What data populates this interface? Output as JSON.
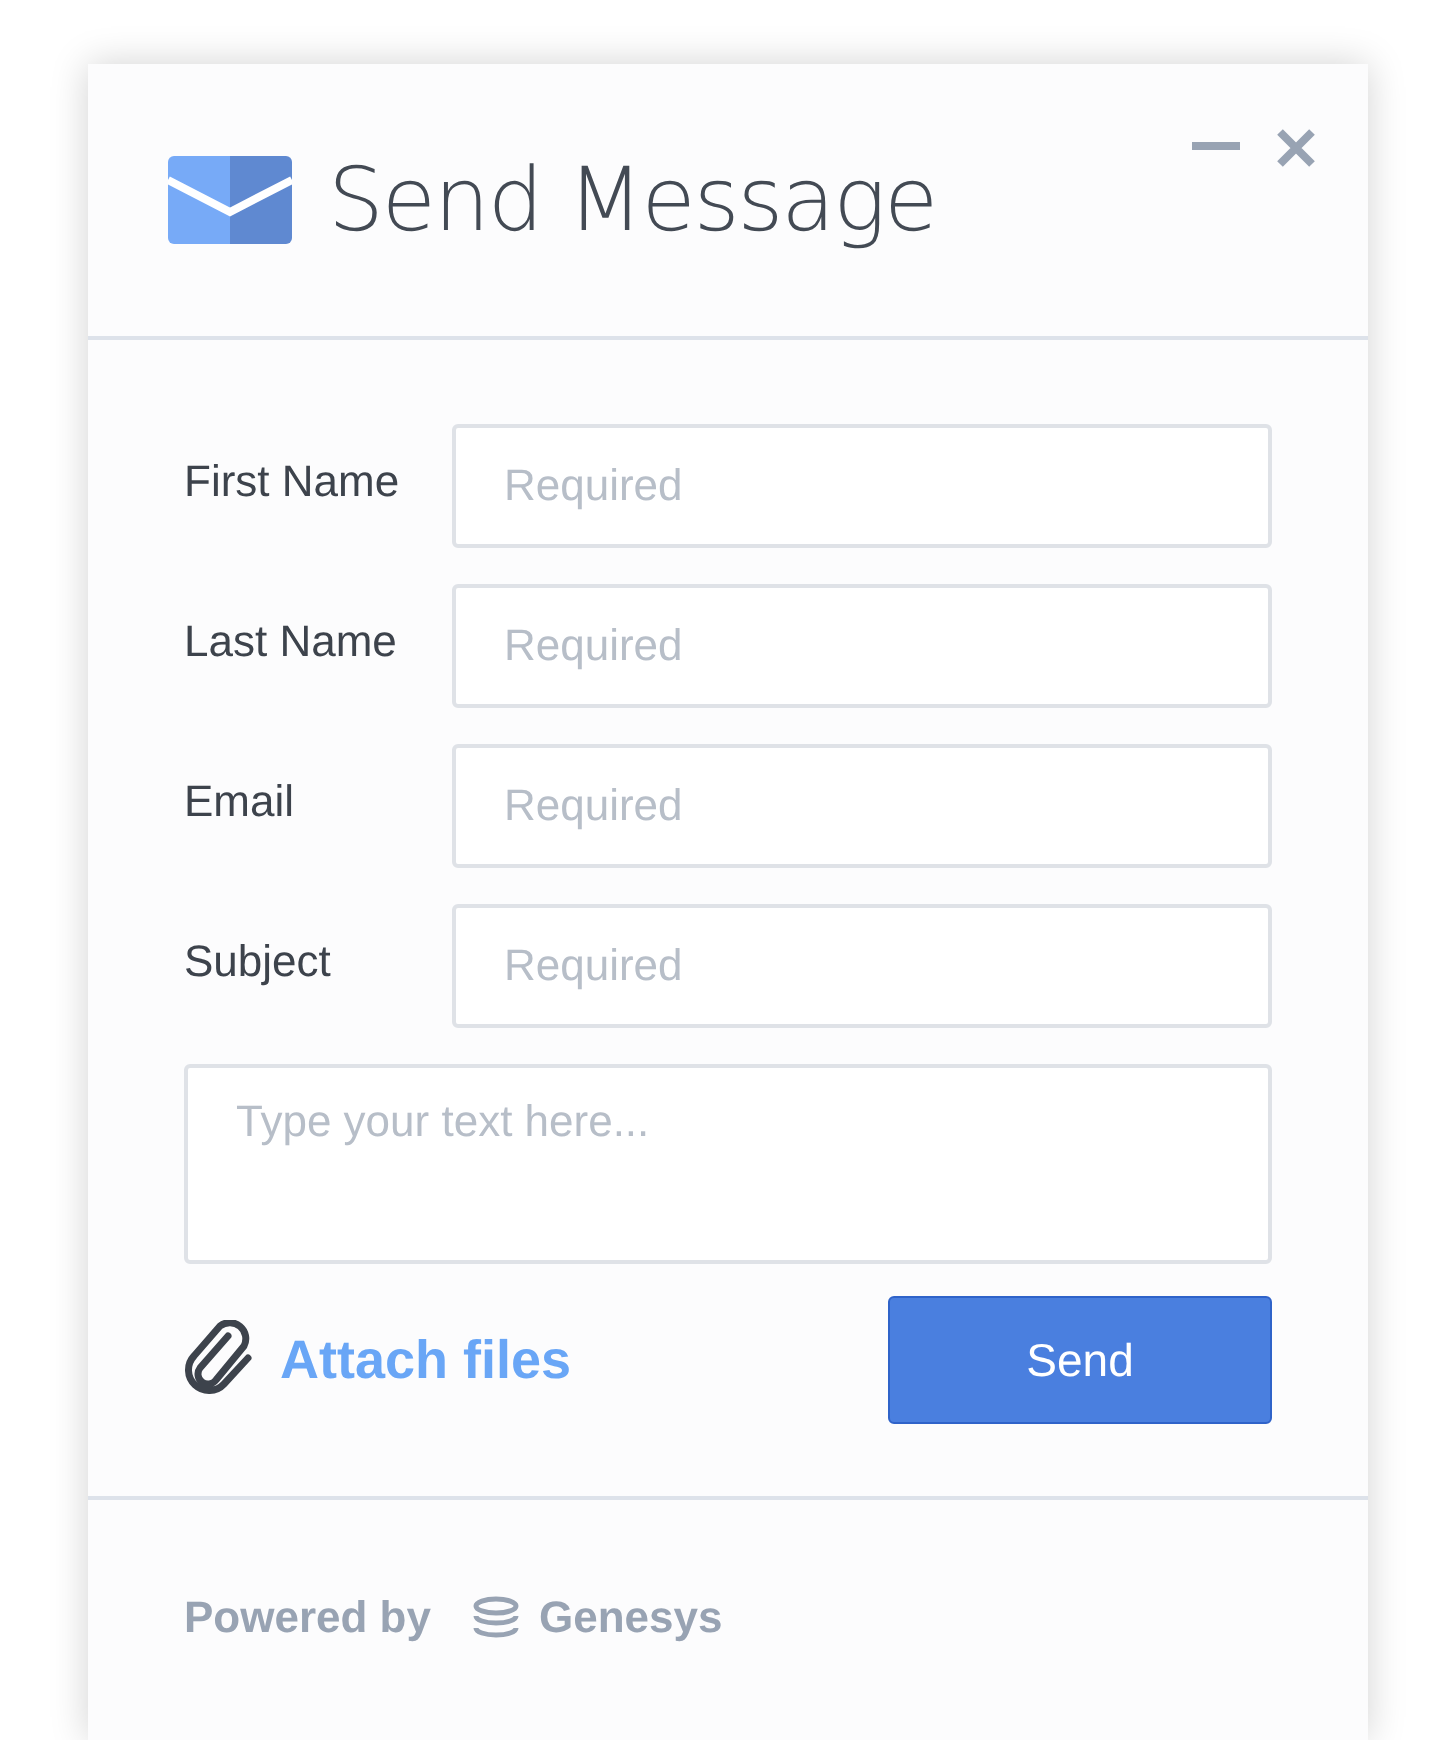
{
  "window": {
    "title": "Send Message"
  },
  "fields": [
    {
      "label": "First Name",
      "placeholder": "Required"
    },
    {
      "label": "Last Name",
      "placeholder": "Required"
    },
    {
      "label": "Email",
      "placeholder": "Required"
    },
    {
      "label": "Subject",
      "placeholder": "Required"
    }
  ],
  "message": {
    "placeholder": "Type your text here..."
  },
  "attach": {
    "label": "Attach files"
  },
  "send_button": "Send",
  "footer": {
    "powered_by": "Powered by",
    "brand": "Genesys"
  }
}
